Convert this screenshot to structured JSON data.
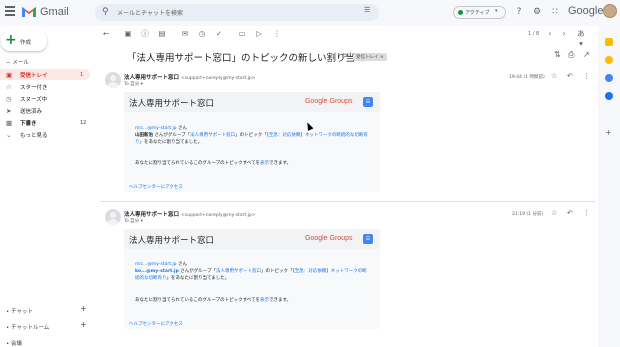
{
  "app": {
    "name": "Gmail",
    "brand_color": "#ea4335",
    "google_label": "Google"
  },
  "search": {
    "placeholder": "メールとチャットを検索"
  },
  "status": {
    "label": "アクティブ",
    "color": "#1e8e3e"
  },
  "sidebar": {
    "compose_label": "作成",
    "section_label": "メール",
    "items": [
      {
        "label": "受信トレイ",
        "icon": "inbox-icon",
        "count": "1",
        "active": true
      },
      {
        "label": "スター付き",
        "icon": "star-icon",
        "count": ""
      },
      {
        "label": "スヌーズ中",
        "icon": "clock-icon",
        "count": ""
      },
      {
        "label": "送信済み",
        "icon": "send-icon",
        "count": ""
      },
      {
        "label": "下書き",
        "icon": "draft-icon",
        "count": "12"
      },
      {
        "label": "もっと見る",
        "icon": "chevron-down-icon",
        "count": ""
      }
    ],
    "chat_label": "チャット",
    "chatroom_label": "チャットルーム",
    "meet_label": "会議"
  },
  "toolbar": {
    "pager": "1 / 8",
    "lang": "あ"
  },
  "thread": {
    "subject": "「法人専用サポート窓口」のトピックの新しい割り当て",
    "label_chip": "受信トレイ"
  },
  "messages": [
    {
      "sender": "法人専用サポート窓口",
      "sender_email": "<support+noreply@my-start.jp>",
      "to": "To 自分",
      "time": "19:44 (1 時間前)",
      "card_title": "法人専用サポート窓口",
      "groups_label": "Google Groups",
      "line1_link": "mic...@my-start.jp",
      "line1_suffix": " さん",
      "line2_name": "山田新治",
      "line2_text": " さんがグループ「",
      "line2_group": "法人専用サポート窓口",
      "line2_mid": "」のトピック「",
      "line2_topic": "【至急：対応依頼】ネットワークの断続的な切断有り",
      "line2_end": "」をあなたに割り当てました。",
      "notice": "あなたに割り当てられているこのグループのトピックすべてを",
      "notice_link": "表示",
      "notice_end": "できます。",
      "footer_link": "ヘルプセンターにアクセス"
    },
    {
      "sender": "法人専用サポート窓口",
      "sender_email": "<support+noreply@my-start.jp>",
      "to": "To 自分",
      "time": "21:19 (1 分前)",
      "card_title": "法人専用サポート窓口",
      "groups_label": "Google Groups",
      "line1_link": "mic...@my-start.jp",
      "line1_suffix": " さん",
      "line2_name": "ko...@my-start.jp",
      "line2_text": " さんがグループ「",
      "line2_group": "法人専用サポート窓口",
      "line2_mid": "」のトピック「",
      "line2_topic": "【至急：対応依頼】ネットワークの断続的な切断有り",
      "line2_end": "」をあなたに割り当てました。",
      "notice": "あなたに割り当てられているこのグループのトピックすべてを",
      "notice_link": "表示",
      "notice_end": "できます。",
      "footer_link": "ヘルプセンターにアクセス"
    }
  ]
}
